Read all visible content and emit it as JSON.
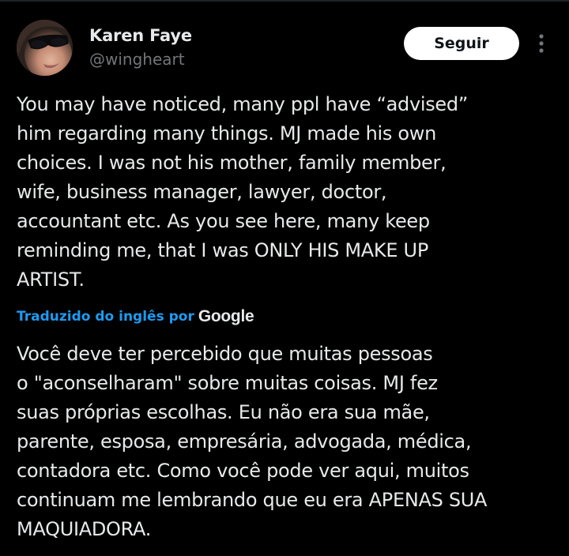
{
  "author": {
    "display_name": "Karen Faye",
    "handle": "@wingheart"
  },
  "actions": {
    "follow_label": "Seguir",
    "more_icon": "more-vertical-icon"
  },
  "post": {
    "text": "You may have noticed, many ppl have “advised”\nhim regarding many things. MJ made his own\nchoices. I was not his mother, family member,\nwife, business manager, lawyer, doctor,\naccountant etc. As you see here, many keep\nreminding me, that I was ONLY HIS MAKE UP\nARTIST."
  },
  "translation": {
    "label": "Traduzido do inglês por",
    "provider": "Google",
    "text": "Você deve ter percebido que muitas pessoas\no \"aconselharam\" sobre muitas coisas. MJ fez\nsuas próprias escolhas. Eu não era sua mãe,\nparente, esposa, empresária, advogada, médica,\ncontadora etc. Como você pode ver aqui, muitos\ncontinuam me lembrando que eu era APENAS SUA\nMAQUIADORA."
  },
  "colors": {
    "background": "#000000",
    "text_primary": "#e7e9ea",
    "text_secondary": "#71767b",
    "accent": "#1d9bf0",
    "button_bg": "#ffffff"
  }
}
